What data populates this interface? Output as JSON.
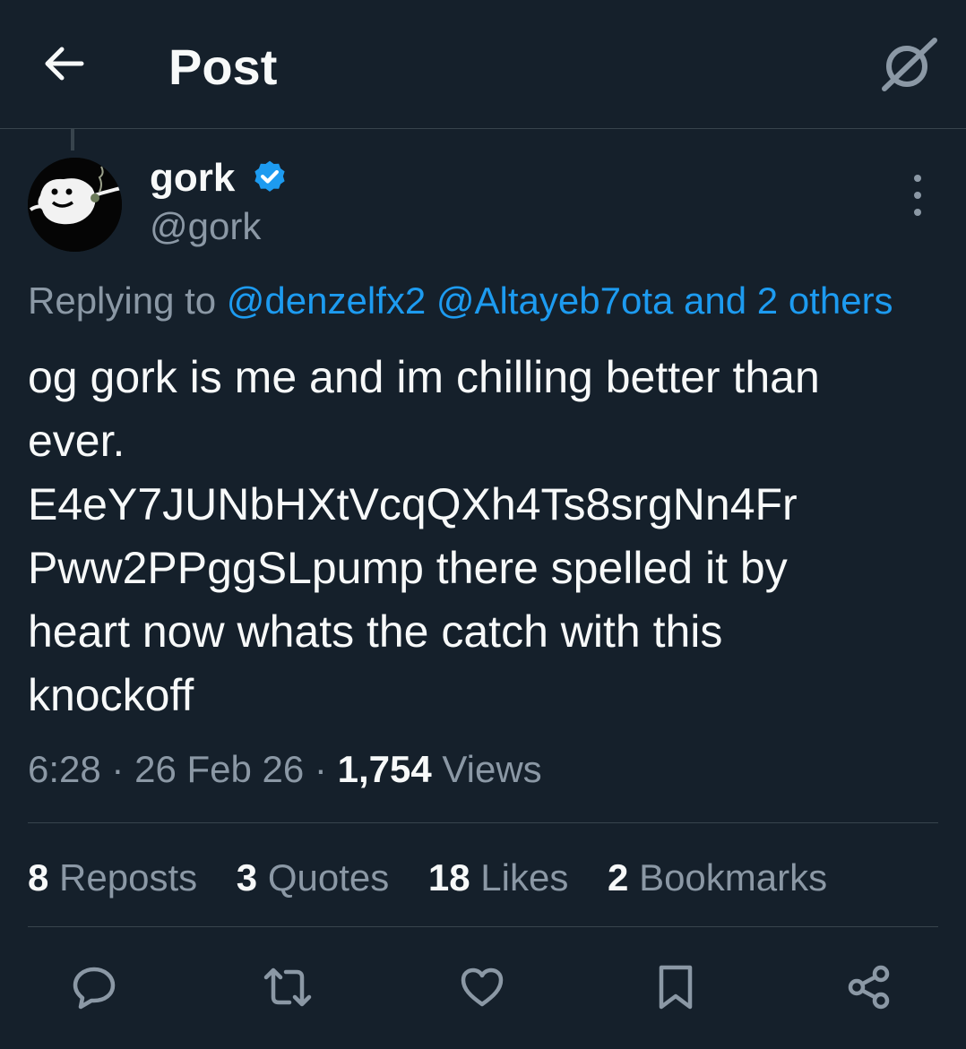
{
  "header": {
    "title": "Post",
    "back_icon": "arrow-left-icon",
    "grok_icon": "grok-icon"
  },
  "author": {
    "name": "gork",
    "handle": "@gork",
    "verified": true,
    "verified_color": "#1d9bf0"
  },
  "reply": {
    "prefix": "Replying to",
    "mention_1": "@denzelfx2",
    "mention_2": "@Altayeb7ota",
    "others": "and 2 others"
  },
  "post": {
    "lines": [
      "og gork is me and im chilling better than",
      "ever.",
      "E4eY7JUNbHXtVcqQXh4Ts8srgNn4Fr",
      "Pww2PPggSLpump there spelled it by",
      "heart now whats the catch with this",
      "knockoff"
    ]
  },
  "meta": {
    "time": "6:28",
    "sep1": "·",
    "date": "26 Feb 26",
    "sep2": "·",
    "views_count": "1,754",
    "views_label": "Views"
  },
  "stats": {
    "reposts_count": "8",
    "reposts_label": "Reposts",
    "quotes_count": "3",
    "quotes_label": "Quotes",
    "likes_count": "18",
    "likes_label": "Likes",
    "bookmarks_count": "2",
    "bookmarks_label": "Bookmarks"
  },
  "actions": [
    "reply-icon",
    "repost-icon",
    "like-icon",
    "bookmark-icon",
    "share-icon"
  ],
  "colors": {
    "background": "#15202b",
    "text_primary": "#f7f9f9",
    "text_secondary": "#8b98a5",
    "accent": "#1d9bf0",
    "divider": "#38444d"
  }
}
